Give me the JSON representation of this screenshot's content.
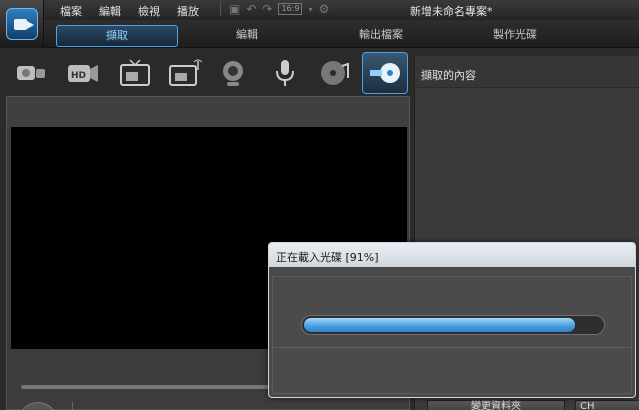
{
  "menu": {
    "items": [
      "檔案",
      "編輯",
      "檢視",
      "播放"
    ]
  },
  "quick_tools": {
    "ratio_label": "16:9"
  },
  "window": {
    "title": "新增未命名專案*"
  },
  "tabs": [
    {
      "label": "擷取",
      "active": true
    },
    {
      "label": "編輯",
      "active": false
    },
    {
      "label": "輸出檔案",
      "active": false
    },
    {
      "label": "製作光碟",
      "active": false
    }
  ],
  "capture_sources": [
    {
      "icon": "dv-camcorder-icon"
    },
    {
      "icon": "hdv-camcorder-icon"
    },
    {
      "icon": "tv-icon"
    },
    {
      "icon": "digital-tv-icon"
    },
    {
      "icon": "webcam-icon"
    },
    {
      "icon": "microphone-icon"
    },
    {
      "icon": "cd-audio-icon"
    },
    {
      "icon": "optical-disc-capture-icon",
      "selected": true
    }
  ],
  "right_panel": {
    "header": "擷取的內容",
    "bottom_button": "變更資料夾",
    "bottom_button2": "CH"
  },
  "dialog": {
    "title": "正在載入光碟 [91%]",
    "progress": 0.91
  },
  "colors": {
    "accent": "#4da3e6",
    "progress_fill": "#4aa0e0",
    "background": "#2b2b2b"
  }
}
